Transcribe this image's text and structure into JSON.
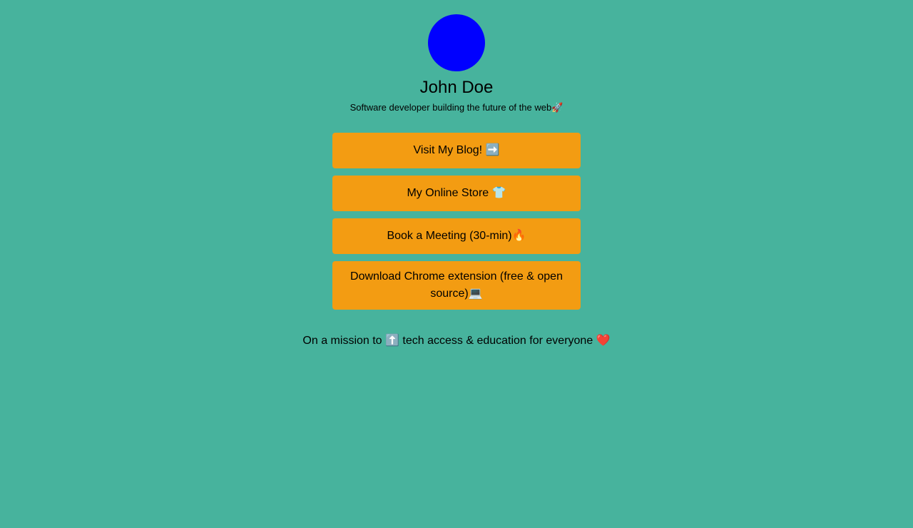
{
  "profile": {
    "name": "John Doe",
    "bio": "Software developer building the future of the web🚀",
    "avatar_color": "#0000ff"
  },
  "links": [
    {
      "label": "Visit My Blog! ➡️"
    },
    {
      "label": "My Online Store 👕"
    },
    {
      "label": "Book a Meeting (30-min)🔥"
    },
    {
      "label": "Download Chrome extension (free & open source)💻"
    }
  ],
  "mission": "On a mission to ⬆️ tech access & education for everyone ❤️",
  "colors": {
    "background": "#47b39d",
    "button": "#f39c12",
    "text": "#000000"
  }
}
